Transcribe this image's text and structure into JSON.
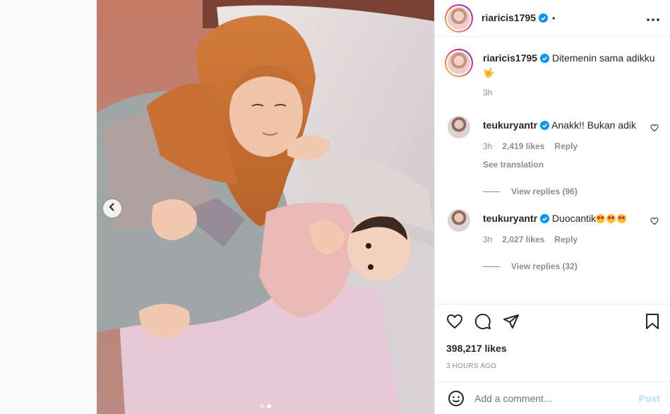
{
  "post": {
    "author": "riaricis1795",
    "header_separator": "•",
    "caption_text": "Ditemenin sama adikku",
    "caption_emoji": "🤟",
    "caption_time": "3h",
    "image_count": 2,
    "active_image": 2
  },
  "comments": [
    {
      "user": "teukuryantr",
      "text": "Anakk!! Bukan adik",
      "time": "3h",
      "likes": "2,419 likes",
      "reply_label": "Reply",
      "see_translation": "See translation",
      "view_replies": "View replies (96)"
    },
    {
      "user": "teukuryantr",
      "text": "Duocantik",
      "time": "3h",
      "likes": "2,027 likes",
      "reply_label": "Reply",
      "view_replies": "View replies (32)"
    }
  ],
  "actions": {
    "likes_count": "398,217 likes",
    "timestamp": "3 HOURS AGO"
  },
  "composer": {
    "placeholder": "Add a comment...",
    "post_label": "Post"
  },
  "icons": {
    "verified": "verified-badge-icon",
    "more": "more-options-icon",
    "like": "heart-icon",
    "comment": "comment-bubble-icon",
    "share": "paper-plane-icon",
    "save": "bookmark-icon",
    "emoji": "smiley-icon",
    "prev": "chevron-left-icon"
  },
  "colors": {
    "verified_blue": "#0095f6",
    "post_button_disabled": "#b2dffc",
    "muted_text": "#8e8e8e"
  }
}
